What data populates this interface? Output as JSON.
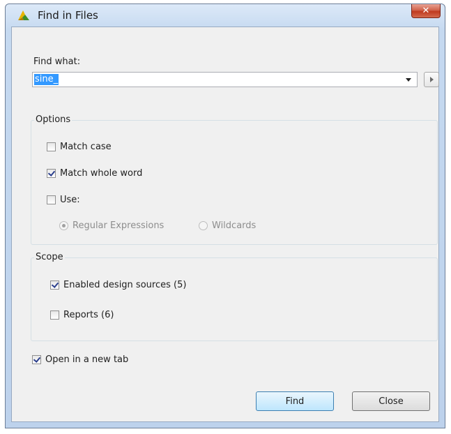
{
  "window": {
    "title": "Find in Files",
    "close_glyph": "✕"
  },
  "find": {
    "label": "Find what:",
    "value": "sine_"
  },
  "options": {
    "legend": "Options",
    "match_case": {
      "label": "Match case",
      "checked": false
    },
    "match_whole_word": {
      "label": "Match whole word",
      "checked": true
    },
    "use": {
      "label": "Use:",
      "checked": false
    },
    "regex": {
      "label": "Regular Expressions",
      "selected": true,
      "enabled": false
    },
    "wildcards": {
      "label": "Wildcards",
      "selected": false,
      "enabled": false
    }
  },
  "scope": {
    "legend": "Scope",
    "enabled_design_sources": {
      "label": "Enabled design sources (5)",
      "checked": true
    },
    "reports": {
      "label": "Reports (6)",
      "checked": false
    }
  },
  "open_new_tab": {
    "label": "Open in a new tab",
    "checked": true
  },
  "buttons": {
    "find": "Find",
    "close": "Close"
  },
  "icons": {
    "app": "vivado-app-icon",
    "close": "close-icon",
    "dropdown": "chevron-down-icon",
    "history": "play-arrow-icon"
  },
  "colors": {
    "selection": "#3399ff",
    "close_button": "#c03a1f",
    "default_button_border": "#3c7fb1"
  }
}
